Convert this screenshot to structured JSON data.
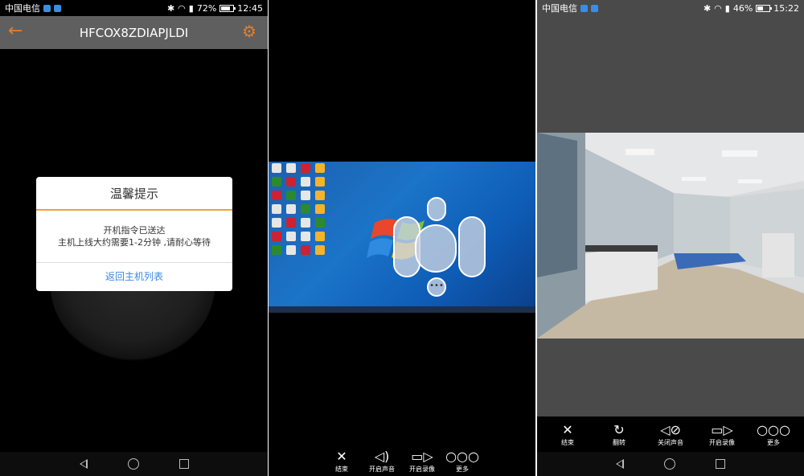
{
  "panel1": {
    "status": {
      "carrier": "中国电信",
      "battery": "72%",
      "time": "12:45",
      "battery_level": 0.72
    },
    "appbar": {
      "title": "HFCOX8ZDIAPJLDI",
      "back_icon": "arrow-left-icon",
      "settings_icon": "gear-icon"
    },
    "dialog": {
      "title": "温馨提示",
      "line1": "开机指令已送达",
      "line2": "主机上线大约需要1-2分钟 ,请耐心等待",
      "action": "返回主机列表"
    }
  },
  "panel2": {
    "actions": [
      {
        "icon": "close-icon",
        "label": "结束"
      },
      {
        "icon": "speaker-icon",
        "label": "开启声音"
      },
      {
        "icon": "video-camera-icon",
        "label": "开启录像"
      },
      {
        "icon": "more-icon",
        "label": "更多"
      }
    ]
  },
  "panel3": {
    "status": {
      "carrier": "中国电信",
      "battery": "46%",
      "time": "15:22",
      "battery_level": 0.46
    },
    "actions": [
      {
        "icon": "close-icon",
        "label": "结束"
      },
      {
        "icon": "rotate-icon",
        "label": "翻转"
      },
      {
        "icon": "mute-icon",
        "label": "关闭声音"
      },
      {
        "icon": "video-camera-icon",
        "label": "开启录像"
      },
      {
        "icon": "more-icon",
        "label": "更多"
      }
    ]
  },
  "colors": {
    "accent_orange": "#e9a33a",
    "link_blue": "#3b8ae0",
    "appbar_gray": "#5f5f5f"
  }
}
